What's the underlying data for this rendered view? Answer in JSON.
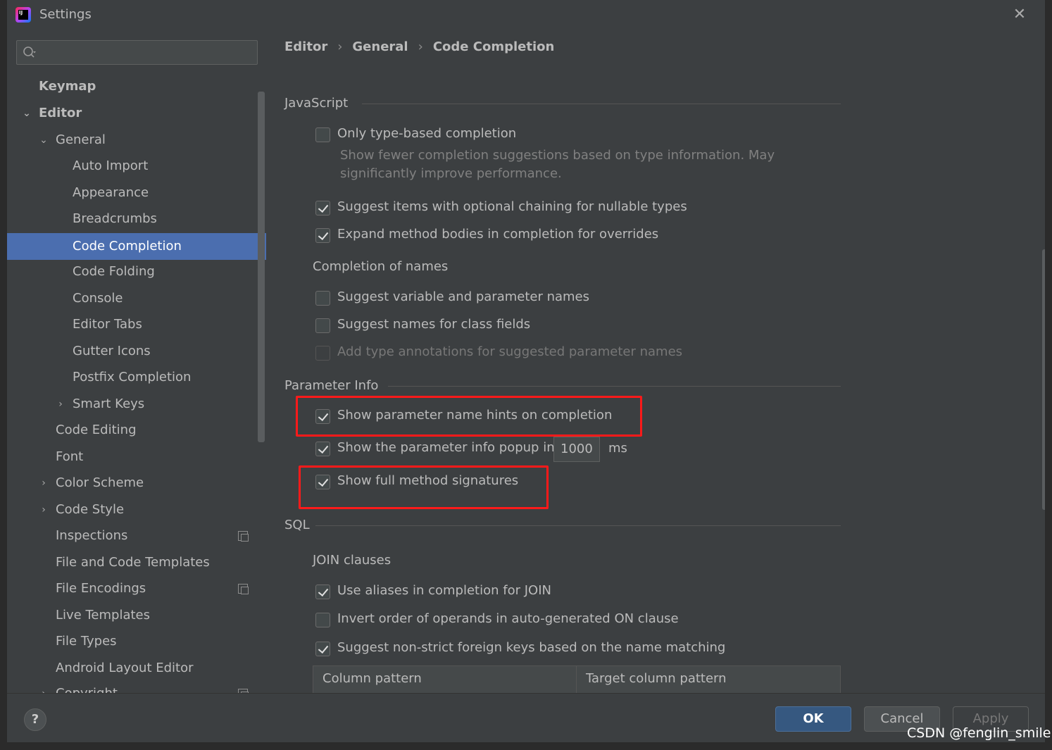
{
  "window": {
    "title": "Settings"
  },
  "search": {
    "placeholder": ""
  },
  "breadcrumb": [
    "Editor",
    "General",
    "Code Completion"
  ],
  "sidebar": {
    "items": [
      {
        "label": "Keymap"
      },
      {
        "label": "Editor"
      },
      {
        "label": "General"
      },
      {
        "label": "Auto Import"
      },
      {
        "label": "Appearance"
      },
      {
        "label": "Breadcrumbs"
      },
      {
        "label": "Code Completion"
      },
      {
        "label": "Code Folding"
      },
      {
        "label": "Console"
      },
      {
        "label": "Editor Tabs"
      },
      {
        "label": "Gutter Icons"
      },
      {
        "label": "Postfix Completion"
      },
      {
        "label": "Smart Keys"
      },
      {
        "label": "Code Editing"
      },
      {
        "label": "Font"
      },
      {
        "label": "Color Scheme"
      },
      {
        "label": "Code Style"
      },
      {
        "label": "Inspections"
      },
      {
        "label": "File and Code Templates"
      },
      {
        "label": "File Encodings"
      },
      {
        "label": "Live Templates"
      },
      {
        "label": "File Types"
      },
      {
        "label": "Android Layout Editor"
      },
      {
        "label": "Copyright"
      }
    ]
  },
  "javascript": {
    "heading": "JavaScript",
    "only_type_based": {
      "label": "Only type-based completion",
      "checked": false
    },
    "only_type_based_desc": "Show fewer completion suggestions based on type information. May significantly improve performance.",
    "optional_chaining": {
      "label": "Suggest items with optional chaining for nullable types",
      "checked": true
    },
    "expand_method_bodies": {
      "label": "Expand method bodies in completion for overrides",
      "checked": true
    },
    "names_heading": "Completion of names",
    "suggest_variable_names": {
      "label": "Suggest variable and parameter names",
      "checked": false
    },
    "suggest_class_fields": {
      "label": "Suggest names for class fields",
      "checked": false
    },
    "add_type_annotations": {
      "label": "Add type annotations for suggested parameter names",
      "checked": false
    }
  },
  "parameter_info": {
    "heading": "Parameter Info",
    "name_hints": {
      "label": "Show parameter name hints on completion",
      "checked": true
    },
    "info_popup": {
      "label": "Show the parameter info popup in",
      "checked": true,
      "value": "1000",
      "unit": "ms"
    },
    "full_signatures": {
      "label": "Show full method signatures",
      "checked": true
    }
  },
  "sql": {
    "heading": "SQL",
    "join_heading": "JOIN clauses",
    "use_aliases": {
      "label": "Use aliases in completion for JOIN",
      "checked": true
    },
    "invert_operands": {
      "label": "Invert order of operands in auto-generated ON clause",
      "checked": false
    },
    "non_strict_fk": {
      "label": "Suggest non-strict foreign keys based on the name matching",
      "checked": true
    },
    "table_columns": [
      "Column pattern",
      "Target column pattern"
    ]
  },
  "footer": {
    "help": "?",
    "ok": "OK",
    "cancel": "Cancel",
    "apply": "Apply"
  },
  "watermark": "CSDN @fenglin_smile",
  "colors": {
    "background": "#3c3f41",
    "selection": "#4b6eaf",
    "highlight_box": "#ff1a1a",
    "ok_button": "#365880"
  }
}
